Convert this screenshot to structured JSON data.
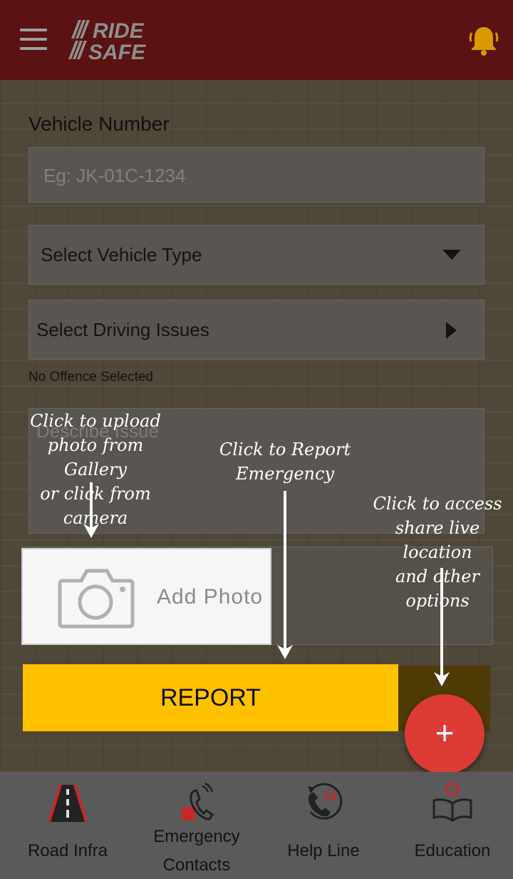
{
  "header": {
    "logo_line1": "RIDE",
    "logo_line2": "SAFE"
  },
  "form": {
    "vehicle_number_label": "Vehicle Number",
    "vehicle_number_placeholder": "Eg: JK-01C-1234",
    "vehicle_type": "Select Vehicle Type",
    "driving_issues": "Select Driving Issues",
    "no_offence": "No Offence Selected",
    "describe_placeholder": "Describe Issue",
    "add_photo": "Add Photo",
    "report": "REPORT",
    "fab_symbol": "+"
  },
  "annotations": {
    "photo_line1": "Click to upload",
    "photo_line2": "photo from Gallery",
    "photo_line3": "or click from camera",
    "report_line1": "Click to Report",
    "report_line2": "Emergency",
    "fab_line1": "Click to access",
    "fab_line2": "share live location",
    "fab_line3": "and other options"
  },
  "nav": {
    "road_infra": "Road Infra",
    "emergency_line1": "Emergency",
    "emergency_line2": "Contacts",
    "help_line": "Help Line",
    "help_badge": "24",
    "education": "Education"
  },
  "colors": {
    "header": "#5a1212",
    "report_button": "#ffc000",
    "fab": "#dc3b35",
    "bell": "#d89a00"
  },
  "icons": [
    "menu-icon",
    "bell-icon",
    "camera-icon",
    "road-icon",
    "emergency-contacts-icon",
    "helpline-24-icon",
    "education-icon"
  ]
}
